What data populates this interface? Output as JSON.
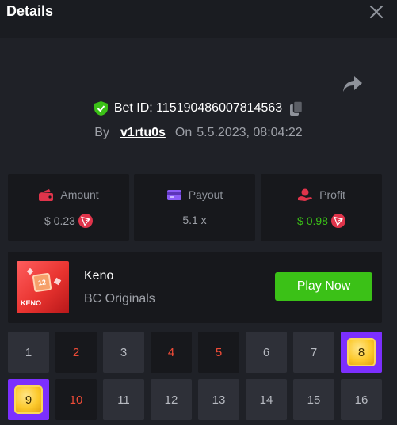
{
  "header": {
    "title": "Details"
  },
  "bet": {
    "id_text": "Bet ID: 115190486007814563",
    "by_label": "By",
    "username": "v1rtu0s",
    "on_label": "On",
    "datetime": "5.5.2023, 08:04:22"
  },
  "stats": {
    "amount": {
      "label": "Amount",
      "value": "$ 0.23",
      "icon": "wallet-icon"
    },
    "payout": {
      "label": "Payout",
      "value": "5.1 x",
      "icon": "card-icon"
    },
    "profit": {
      "label": "Profit",
      "value": "$ 0.98",
      "icon": "profit-icon"
    }
  },
  "game": {
    "name": "Keno",
    "provider": "BC Originals",
    "play_label": "Play Now",
    "thumb_number": "12",
    "thumb_word": "KENO"
  },
  "tiles": [
    {
      "n": "1",
      "state": "normal"
    },
    {
      "n": "2",
      "state": "picked"
    },
    {
      "n": "3",
      "state": "normal"
    },
    {
      "n": "4",
      "state": "picked"
    },
    {
      "n": "5",
      "state": "picked"
    },
    {
      "n": "6",
      "state": "normal"
    },
    {
      "n": "7",
      "state": "normal"
    },
    {
      "n": "8",
      "state": "hit"
    },
    {
      "n": "9",
      "state": "hit"
    },
    {
      "n": "10",
      "state": "picked"
    },
    {
      "n": "11",
      "state": "normal"
    },
    {
      "n": "12",
      "state": "normal"
    },
    {
      "n": "13",
      "state": "normal"
    },
    {
      "n": "14",
      "state": "normal"
    },
    {
      "n": "15",
      "state": "normal"
    },
    {
      "n": "16",
      "state": "normal"
    }
  ],
  "colors": {
    "accent_green": "#3bc117",
    "hit_purple": "#7c2ffe",
    "picked_red": "#ed4b37",
    "currency": "#e0344b"
  }
}
